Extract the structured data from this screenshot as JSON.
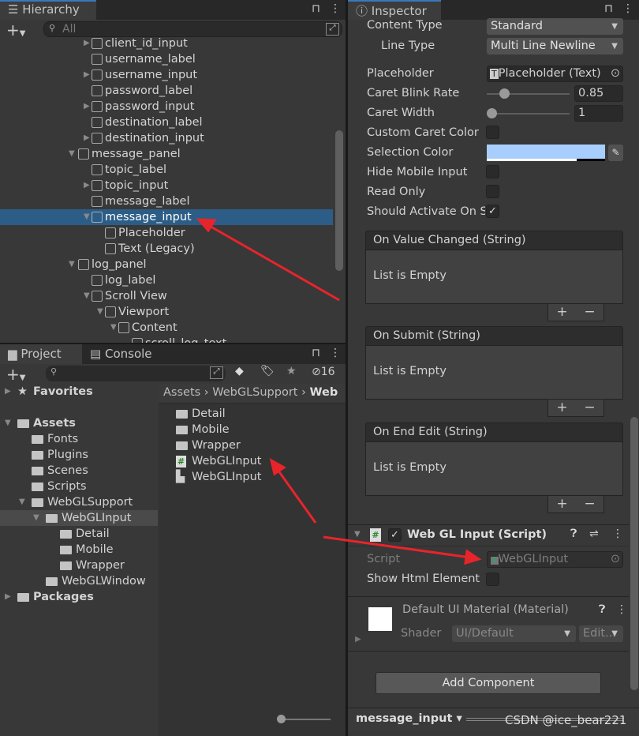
{
  "hierarchy": {
    "tab": "Hierarchy",
    "search_placeholder": "All",
    "items": [
      {
        "label": "client_id_input",
        "depth": 2,
        "arrow": "collapsed"
      },
      {
        "label": "username_label",
        "depth": 2,
        "arrow": "none"
      },
      {
        "label": "username_input",
        "depth": 2,
        "arrow": "collapsed"
      },
      {
        "label": "password_label",
        "depth": 2,
        "arrow": "none"
      },
      {
        "label": "password_input",
        "depth": 2,
        "arrow": "collapsed"
      },
      {
        "label": "destination_label",
        "depth": 2,
        "arrow": "none"
      },
      {
        "label": "destination_input",
        "depth": 2,
        "arrow": "collapsed"
      },
      {
        "label": "message_panel",
        "depth": 1,
        "arrow": "expanded"
      },
      {
        "label": "topic_label",
        "depth": 2,
        "arrow": "none"
      },
      {
        "label": "topic_input",
        "depth": 2,
        "arrow": "collapsed"
      },
      {
        "label": "message_label",
        "depth": 2,
        "arrow": "none"
      },
      {
        "label": "message_input",
        "depth": 2,
        "arrow": "expanded",
        "selected": true
      },
      {
        "label": "Placeholder",
        "depth": 3,
        "arrow": "none"
      },
      {
        "label": "Text (Legacy)",
        "depth": 3,
        "arrow": "none"
      },
      {
        "label": "log_panel",
        "depth": 1,
        "arrow": "expanded"
      },
      {
        "label": "log_label",
        "depth": 2,
        "arrow": "none"
      },
      {
        "label": "Scroll View",
        "depth": 2,
        "arrow": "expanded"
      },
      {
        "label": "Viewport",
        "depth": 3,
        "arrow": "expanded"
      },
      {
        "label": "Content",
        "depth": 4,
        "arrow": "expanded"
      },
      {
        "label": "scroll_log_text",
        "depth": 5,
        "arrow": "none"
      }
    ]
  },
  "project": {
    "tabs": [
      "Project",
      "Console"
    ],
    "hidden_count": "16",
    "breadcrumb": [
      "Assets",
      "WebGLSupport",
      "Web"
    ],
    "tree": [
      {
        "label": "Favorites",
        "depth": 0,
        "arrow": "collapsed",
        "icon": "star",
        "bold": true
      },
      {
        "label": "Assets",
        "depth": 0,
        "arrow": "expanded",
        "icon": "folder-open",
        "bold": true
      },
      {
        "label": "Fonts",
        "depth": 1,
        "icon": "folder"
      },
      {
        "label": "Plugins",
        "depth": 1,
        "icon": "folder"
      },
      {
        "label": "Scenes",
        "depth": 1,
        "icon": "folder"
      },
      {
        "label": "Scripts",
        "depth": 1,
        "icon": "folder"
      },
      {
        "label": "WebGLSupport",
        "depth": 1,
        "arrow": "expanded",
        "icon": "folder-open"
      },
      {
        "label": "WebGLInput",
        "depth": 2,
        "arrow": "expanded",
        "icon": "folder-open",
        "selected": true
      },
      {
        "label": "Detail",
        "depth": 3,
        "icon": "folder"
      },
      {
        "label": "Mobile",
        "depth": 3,
        "icon": "folder"
      },
      {
        "label": "Wrapper",
        "depth": 3,
        "icon": "folder"
      },
      {
        "label": "WebGLWindow",
        "depth": 2,
        "icon": "folder"
      },
      {
        "label": "Packages",
        "depth": 0,
        "arrow": "collapsed",
        "icon": "folder",
        "bold": true
      }
    ],
    "files": [
      {
        "label": "Detail",
        "icon": "folder"
      },
      {
        "label": "Mobile",
        "icon": "folder"
      },
      {
        "label": "Wrapper",
        "icon": "folder"
      },
      {
        "label": "WebGLInput",
        "icon": "csharp-script"
      },
      {
        "label": "WebGLInput",
        "icon": "assembly-definition"
      }
    ]
  },
  "inspector": {
    "tab": "Inspector",
    "content_type": {
      "label": "Content Type",
      "value": "Standard"
    },
    "line_type": {
      "label": "Line Type",
      "value": "Multi Line Newline"
    },
    "placeholder": {
      "label": "Placeholder",
      "value": "Placeholder (Text)"
    },
    "caret_blink_rate": {
      "label": "Caret Blink Rate",
      "value": "0.85",
      "fraction": 0.21
    },
    "caret_width": {
      "label": "Caret Width",
      "value": "1",
      "fraction": 0.0
    },
    "custom_caret_color": {
      "label": "Custom Caret Color",
      "checked": false
    },
    "selection_color": {
      "label": "Selection Color",
      "color": "#a8cefe"
    },
    "hide_mobile_input": {
      "label": "Hide Mobile Input",
      "checked": false
    },
    "read_only": {
      "label": "Read Only",
      "checked": false
    },
    "should_activate": {
      "label": "Should Activate On S",
      "checked": true
    },
    "events": [
      {
        "title": "On Value Changed (String)",
        "body": "List is Empty"
      },
      {
        "title": "On Submit (String)",
        "body": "List is Empty"
      },
      {
        "title": "On End Edit (String)",
        "body": "List is Empty"
      }
    ],
    "webgl_component": {
      "title": "Web GL Input (Script)",
      "enabled": true,
      "script_label": "Script",
      "script_value": "WebGLInput",
      "show_html_label": "Show Html Element",
      "show_html_checked": false
    },
    "material": {
      "title": "Default UI Material (Material)",
      "shader_label": "Shader",
      "shader_value": "UI/Default",
      "edit_label": "Edit..."
    },
    "add_component": "Add Component",
    "footer_object": "message_input"
  },
  "watermark": "CSDN @ice_bear221",
  "colors": {
    "selection": "#2c5d87",
    "annotation_arrow": "#e8242b",
    "accent": "#3a79bb"
  }
}
